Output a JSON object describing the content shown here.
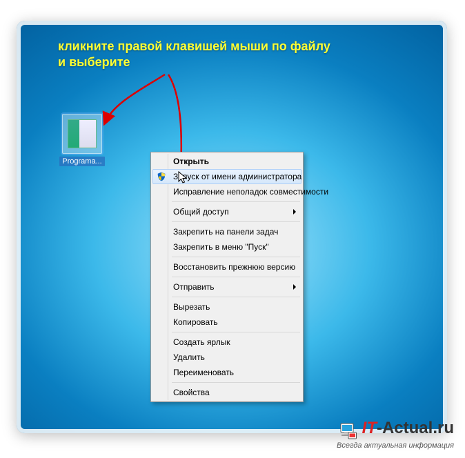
{
  "instruction": "кликните правой клавишей мыши по файлу\nи выберите",
  "desktop_icon": {
    "label": "Programa..."
  },
  "context_menu": {
    "open": "Открыть",
    "run_as_admin": "Запуск от имени администратора",
    "troubleshoot": "Исправление неполадок совместимости",
    "share": "Общий доступ",
    "pin_taskbar": "Закрепить на панели задач",
    "pin_start": "Закрепить в меню \"Пуск\"",
    "restore_prev": "Восстановить прежнюю версию",
    "send_to": "Отправить",
    "cut": "Вырезать",
    "copy": "Копировать",
    "create_shortcut": "Создать ярлык",
    "delete": "Удалить",
    "rename": "Переименовать",
    "properties": "Свойства"
  },
  "watermark": {
    "brand_it": "IT",
    "brand_rest": "-Actual.ru",
    "slogan": "Всегда актуальная информация"
  }
}
